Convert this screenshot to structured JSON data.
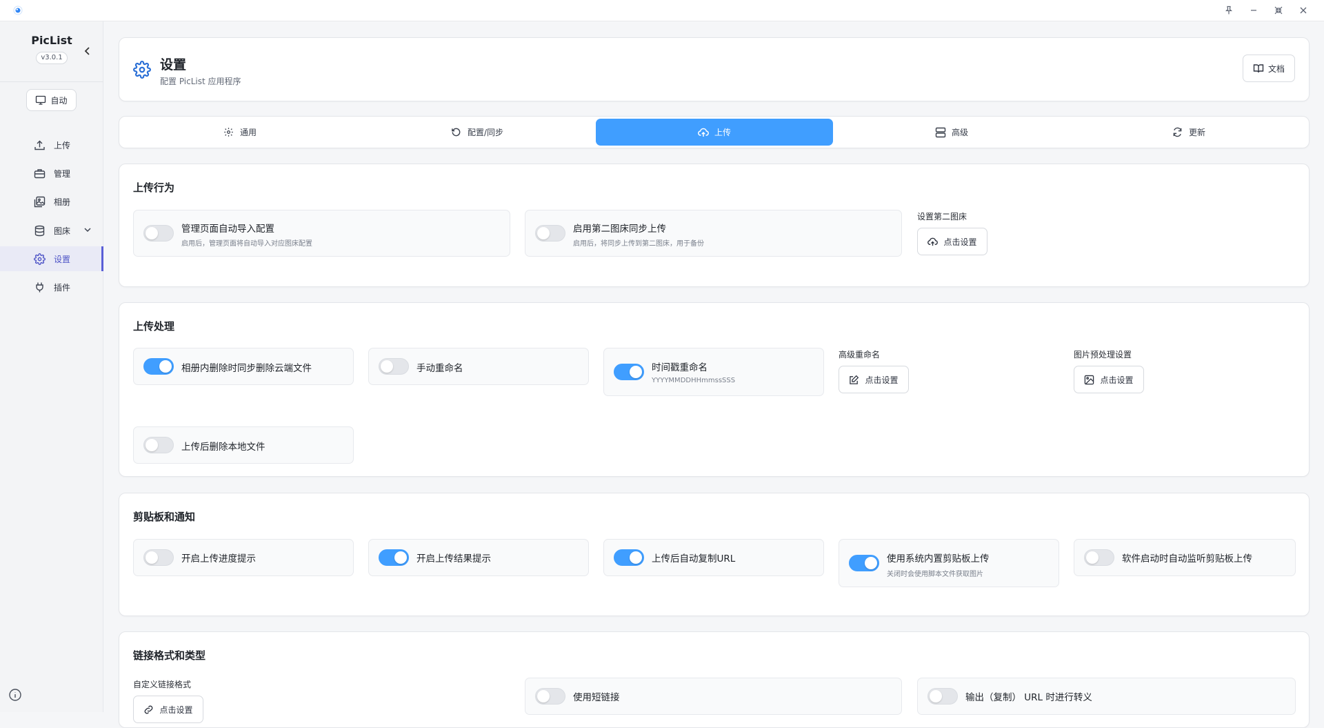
{
  "sidebar": {
    "app_name": "PicList",
    "version": "v3.0.1",
    "mode_label": "自动",
    "items": [
      {
        "label": "上传"
      },
      {
        "label": "管理"
      },
      {
        "label": "相册"
      },
      {
        "label": "图床"
      },
      {
        "label": "设置"
      },
      {
        "label": "插件"
      }
    ],
    "active_item": "设置"
  },
  "header": {
    "title": "设置",
    "subtitle": "配置 PicList 应用程序",
    "docs_label": "文档"
  },
  "tabs": [
    {
      "label": "通用"
    },
    {
      "label": "配置/同步"
    },
    {
      "label": "上传"
    },
    {
      "label": "高级"
    },
    {
      "label": "更新"
    }
  ],
  "active_tab": "上传",
  "sections": {
    "upload_behavior": {
      "title": "上传行为",
      "auto_import": {
        "label": "管理页面自动导入配置",
        "desc": "启用后，管理页面将自动导入对应图床配置",
        "on": false
      },
      "second_sync": {
        "label": "启用第二图床同步上传",
        "desc": "启用后，将同步上传到第二图床，用于备份",
        "on": false
      },
      "second_setting_label": "设置第二图床",
      "second_setting_btn": "点击设置"
    },
    "upload_processing": {
      "title": "上传处理",
      "delete_cloud": {
        "label": "相册内删除时同步删除云端文件",
        "on": true
      },
      "manual_rename": {
        "label": "手动重命名",
        "on": false
      },
      "timestamp_rename": {
        "label": "时间戳重命名",
        "desc": "YYYYMMDDHHmmssSSS",
        "on": true
      },
      "advanced_rename_label": "高级重命名",
      "advanced_rename_btn": "点击设置",
      "image_preprocess_label": "图片预处理设置",
      "image_preprocess_btn": "点击设置",
      "delete_local": {
        "label": "上传后删除本地文件",
        "on": false
      }
    },
    "clipboard": {
      "title": "剪贴板和通知",
      "progress_hint": {
        "label": "开启上传进度提示",
        "on": false
      },
      "result_hint": {
        "label": "开启上传结果提示",
        "on": true
      },
      "auto_copy": {
        "label": "上传后自动复制URL",
        "on": true
      },
      "builtin_clipboard": {
        "label": "使用系统内置剪贴板上传",
        "desc": "关闭时会使用脚本文件获取图片",
        "on": true
      },
      "watch_clipboard": {
        "label": "软件启动时自动监听剪贴板上传",
        "on": false
      }
    },
    "link_format": {
      "title": "链接格式和类型",
      "custom_format_label": "自定义链接格式",
      "custom_format_btn": "点击设置",
      "short_link": {
        "label": "使用短链接",
        "on": false
      },
      "escape_url": {
        "label": "输出（复制） URL 时进行转义",
        "on": false
      }
    }
  },
  "colors": {
    "accent": "#409eff",
    "nav_active": "#5a5fd6",
    "header_icon": "#2a6fd6"
  }
}
